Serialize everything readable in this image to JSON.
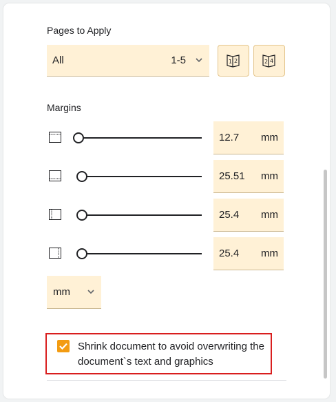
{
  "pages": {
    "label": "Pages to Apply",
    "selected": "All",
    "range": "1-5"
  },
  "margins": {
    "label": "Margins",
    "rows": [
      {
        "side": "top",
        "value": "12.7",
        "unit": "mm",
        "slider_fraction": 0.0
      },
      {
        "side": "bottom",
        "value": "25.51",
        "unit": "mm",
        "slider_fraction": 0.03
      },
      {
        "side": "left",
        "value": "25.4",
        "unit": "mm",
        "slider_fraction": 0.03
      },
      {
        "side": "right",
        "value": "25.4",
        "unit": "mm",
        "slider_fraction": 0.03
      }
    ],
    "unit_selected": "mm"
  },
  "shrink": {
    "checked": true,
    "text": "Shrink document to avoid overwriting the document`s text and graphics"
  },
  "colors": {
    "field_bg": "#fff1d6",
    "checkbox": "#f39c12",
    "highlight_border": "#d91e1e"
  }
}
